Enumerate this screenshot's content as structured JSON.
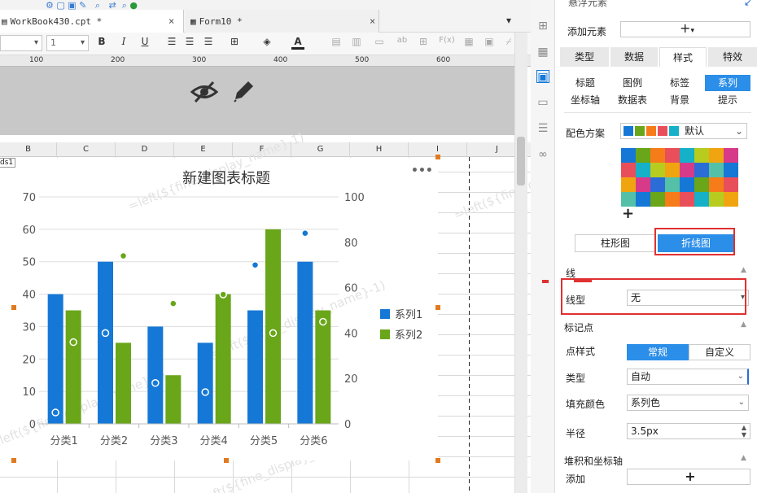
{
  "tabs": [
    {
      "label": "WorkBook430.cpt *",
      "close": "×"
    },
    {
      "label": "Form10 *",
      "close": "×"
    }
  ],
  "format_toolbar": {
    "font_size": "1",
    "bold": "B",
    "italic": "I",
    "underline": "U",
    "text_color": "A",
    "formula": "F(x)",
    "ab": "ab"
  },
  "ruler": {
    "marks": [
      "100",
      "200",
      "300",
      "400",
      "500",
      "600",
      "70"
    ]
  },
  "columns": [
    "B",
    "C",
    "D",
    "E",
    "F",
    "G",
    "H",
    "I",
    "J"
  ],
  "cell_fragment": "ds1",
  "watermark": "=left(${fine_display_name}-1)",
  "chart_menu": "•••",
  "chart_data": {
    "type": "bar",
    "title": "新建图表标题",
    "categories": [
      "分类1",
      "分类2",
      "分类3",
      "分类4",
      "分类5",
      "分类6"
    ],
    "series": [
      {
        "name": "系列1",
        "color": "#1578d6",
        "values": [
          40,
          50,
          30,
          25,
          35,
          50
        ]
      },
      {
        "name": "系列2",
        "color": "#69a619",
        "values": [
          35,
          25,
          15,
          40,
          60,
          35
        ]
      }
    ],
    "points": [
      {
        "series": "系列1",
        "values": [
          5,
          40,
          18,
          14,
          70,
          84
        ]
      },
      {
        "series": "系列2",
        "values": [
          36,
          74,
          53,
          57,
          40,
          45
        ]
      }
    ],
    "left_ticks": [
      "70",
      "60",
      "50",
      "40",
      "30",
      "20",
      "10",
      "0"
    ],
    "right_ticks": [
      "100",
      "80",
      "60",
      "40",
      "20",
      "0"
    ],
    "ylim": [
      0,
      70
    ],
    "y2lim": [
      0,
      100
    ],
    "legend_position": "right"
  },
  "panel": {
    "title": "悬浮元素",
    "add_element_label": "添加元素",
    "add_plus": "+",
    "main_tabs": [
      "类型",
      "数据",
      "样式",
      "特效"
    ],
    "main_tab_active": "样式",
    "sub_tabs_row1": [
      "标题",
      "图例",
      "标签",
      "系列"
    ],
    "sub_tabs_row2": [
      "坐标轴",
      "数据表",
      "背景",
      "提示"
    ],
    "sub_tab_active": "系列",
    "color_scheme_label": "配色方案",
    "color_scheme_value": "默认",
    "palette_colors": [
      "#1578d6",
      "#69a619",
      "#f57c18",
      "#e94f5a",
      "#16b0c8",
      "#b8cc20",
      "#f0a510",
      "#d83a8a",
      "#2b6cd6",
      "#55c0a8"
    ],
    "add_color": "+",
    "chart_types": [
      "柱形图",
      "折线图"
    ],
    "chart_type_active": "折线图",
    "section_line": "线",
    "line_type_label": "线型",
    "line_type_value": "无",
    "section_marker": "标记点",
    "point_style_label": "点样式",
    "point_style_options": [
      "常规",
      "自定义"
    ],
    "point_style_active": "常规",
    "marker_type_label": "类型",
    "marker_type_value": "自动",
    "fill_color_label": "填充颜色",
    "fill_color_value": "系列色",
    "radius_label": "半径",
    "radius_value": "3.5px",
    "section_stack": "堆积和坐标轴",
    "add_label": "添加",
    "add_button": "+"
  }
}
